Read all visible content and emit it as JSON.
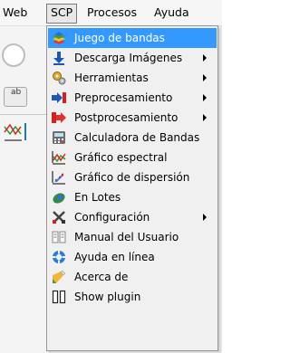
{
  "menubar": {
    "web": "Web",
    "scp": "SCP",
    "procesos": "Procesos",
    "ayuda": "Ayuda"
  },
  "background": {
    "button_label": "ab"
  },
  "scp_menu": {
    "items": [
      {
        "label": "Juego de bandas",
        "icon": "band-set-icon",
        "selected": true,
        "submenu": false
      },
      {
        "label": "Descarga Imágenes",
        "icon": "download-images-icon",
        "selected": false,
        "submenu": true
      },
      {
        "label": "Herramientas",
        "icon": "tools-icon",
        "selected": false,
        "submenu": true
      },
      {
        "label": "Preprocesamiento",
        "icon": "preprocessing-icon",
        "selected": false,
        "submenu": true
      },
      {
        "label": "Postprocesamiento",
        "icon": "postprocessing-icon",
        "selected": false,
        "submenu": true
      },
      {
        "label": "Calculadora de Bandas",
        "icon": "band-calculator-icon",
        "selected": false,
        "submenu": false
      },
      {
        "label": "Gráfico espectral",
        "icon": "spectral-plot-icon",
        "selected": false,
        "submenu": false
      },
      {
        "label": "Gráfico de dispersión",
        "icon": "scatter-plot-icon",
        "selected": false,
        "submenu": false
      },
      {
        "label": "En Lotes",
        "icon": "batch-icon",
        "selected": false,
        "submenu": false
      },
      {
        "label": "Configuración",
        "icon": "settings-icon",
        "selected": false,
        "submenu": true
      },
      {
        "label": "Manual del Usuario",
        "icon": "user-manual-icon",
        "selected": false,
        "submenu": false
      },
      {
        "label": "Ayuda en línea",
        "icon": "online-help-icon",
        "selected": false,
        "submenu": false
      },
      {
        "label": "Acerca de",
        "icon": "about-icon",
        "selected": false,
        "submenu": false
      },
      {
        "label": "Show plugin",
        "icon": "show-plugin-icon",
        "selected": false,
        "submenu": false
      }
    ]
  },
  "colors": {
    "selection": "#3399ff",
    "menu_background": "#f0f0f0"
  }
}
